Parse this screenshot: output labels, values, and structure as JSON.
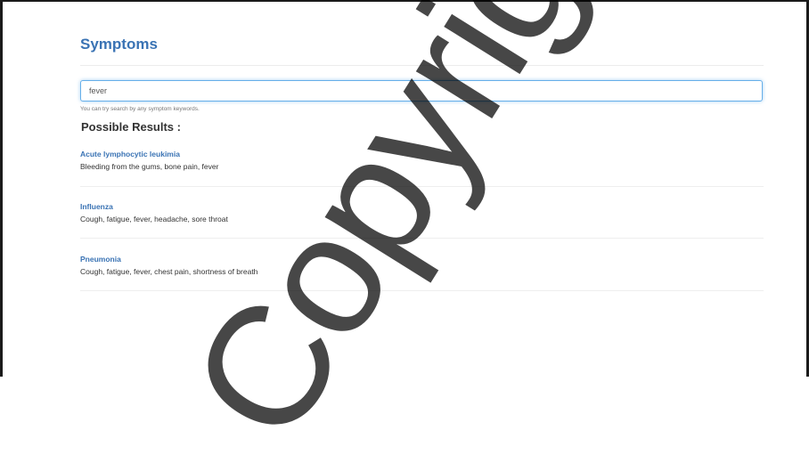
{
  "page": {
    "title": "Symptoms"
  },
  "search": {
    "value": "fever",
    "help": "You can try search by any symptom keywords."
  },
  "results": {
    "heading": "Possible Results :",
    "items": [
      {
        "name": "Acute lymphocytic leukimia",
        "symptoms": "Bleeding from the gums, bone pain, fever"
      },
      {
        "name": "Influenza",
        "symptoms": "Cough, fatigue, fever, headache, sore throat"
      },
      {
        "name": "Pneumonia",
        "symptoms": "Cough, fatigue, fever, chest pain, shortness of breath"
      }
    ]
  },
  "watermark": {
    "text": "Copyright@R"
  },
  "colors": {
    "accent": "#3a73b4",
    "focus_border": "#66afe9",
    "text": "#333333",
    "muted": "#777777"
  }
}
